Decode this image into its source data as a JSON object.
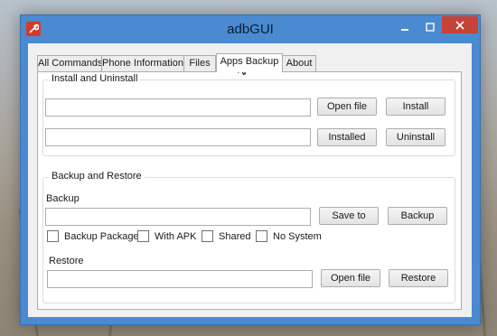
{
  "window": {
    "title": "adbGUI"
  },
  "tabs": [
    {
      "label": "All Commands"
    },
    {
      "label": "Phone Information"
    },
    {
      "label": "Files"
    },
    {
      "label": "Apps Backup"
    },
    {
      "label": "About"
    }
  ],
  "active_tab": "Apps Backup",
  "install_group": {
    "label": "Install and Uninstall",
    "row1": {
      "value": "",
      "open_label": "Open file",
      "install_label": "Install"
    },
    "row2": {
      "value": "",
      "installed_label": "Installed",
      "uninstall_label": "Uninstall"
    }
  },
  "backup_group": {
    "label": "Backup and Restore",
    "backup_label": "Backup",
    "backup_value": "",
    "save_to_label": "Save to",
    "backup_button_label": "Backup",
    "options": [
      {
        "label": "Backup Package",
        "checked": false
      },
      {
        "label": "With APK",
        "checked": false
      },
      {
        "label": "Shared",
        "checked": false
      },
      {
        "label": "No System",
        "checked": false
      }
    ],
    "restore_label": "Restore",
    "restore_value": "",
    "restore_open_label": "Open file",
    "restore_button_label": "Restore"
  },
  "icons": {
    "app": "wrench-icon",
    "minimize": "minimize-icon",
    "maximize": "maximize-icon",
    "close": "close-icon"
  }
}
